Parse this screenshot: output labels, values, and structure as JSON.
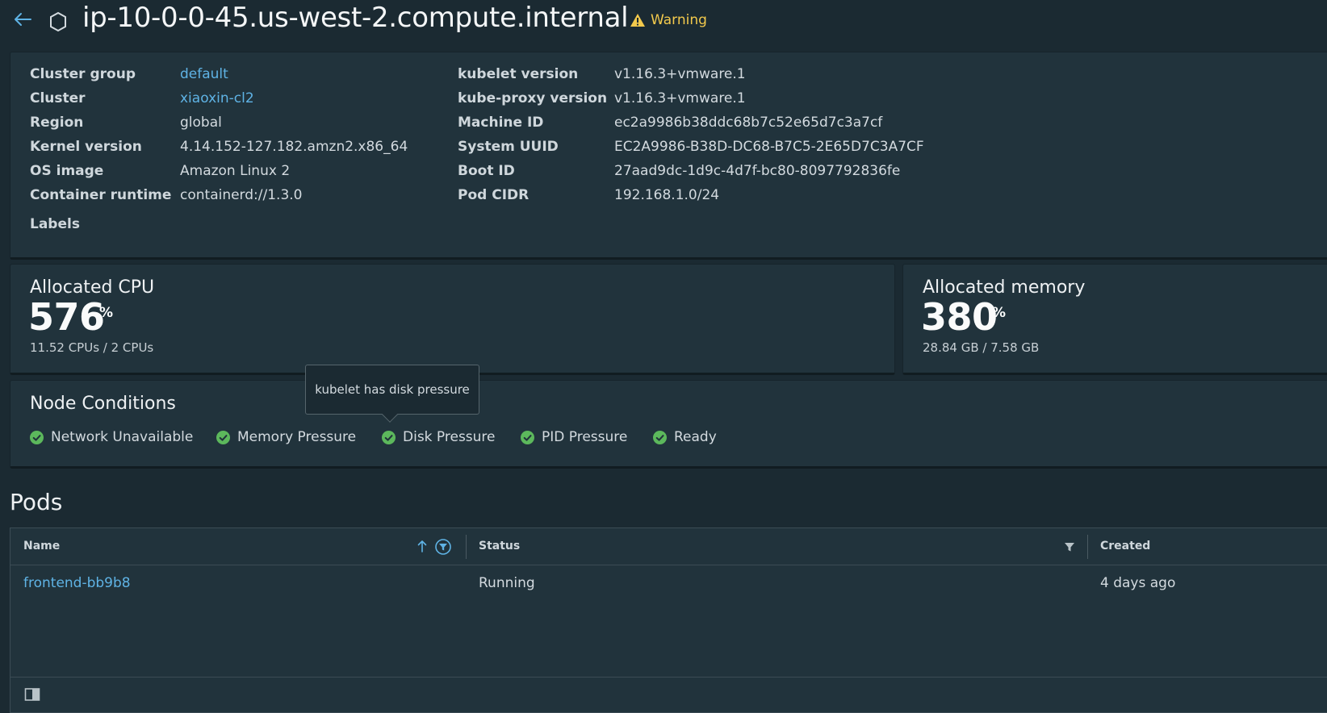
{
  "header": {
    "title": "ip-10-0-0-45.us-west-2.compute.internal",
    "warning_label": "Warning",
    "back_icon": "arrow-left-icon",
    "node_icon": "hexagon-icon",
    "warning_icon": "warning-triangle-icon"
  },
  "details": {
    "left": [
      {
        "key": "Cluster group",
        "value": "default",
        "link": true
      },
      {
        "key": "Cluster",
        "value": "xiaoxin-cl2",
        "link": true
      },
      {
        "key": "Region",
        "value": "global",
        "link": false
      },
      {
        "key": "Kernel version",
        "value": "4.14.152-127.182.amzn2.x86_64",
        "link": false
      },
      {
        "key": "OS image",
        "value": "Amazon Linux 2",
        "link": false
      },
      {
        "key": "Container runtime",
        "value": "containerd://1.3.0",
        "link": false
      }
    ],
    "right": [
      {
        "key": "kubelet version",
        "value": "v1.16.3+vmware.1"
      },
      {
        "key": "kube-proxy version",
        "value": "v1.16.3+vmware.1"
      },
      {
        "key": "Machine ID",
        "value": "ec2a9986b38ddc68b7c52e65d7c3a7cf"
      },
      {
        "key": "System UUID",
        "value": "EC2A9986-B38D-DC68-B7C5-2E65D7C3A7CF"
      },
      {
        "key": "Boot ID",
        "value": "27aad9dc-1d9c-4d7f-bc80-8097792836fe"
      },
      {
        "key": "Pod CIDR",
        "value": "192.168.1.0/24"
      }
    ],
    "labels_key": "Labels"
  },
  "cpu": {
    "title": "Allocated CPU",
    "value": "576",
    "unit": "%",
    "sub": "11.52 CPUs / 2 CPUs"
  },
  "memory": {
    "title": "Allocated memory",
    "value": "380",
    "unit": "%",
    "sub": "28.84 GB / 7.58 GB"
  },
  "conditions": {
    "title": "Node Conditions",
    "items": [
      "Network Unavailable",
      "Memory Pressure",
      "Disk Pressure",
      "PID Pressure",
      "Ready"
    ],
    "status_icon": "check-circle-icon",
    "status_color": "#5cb85c",
    "tooltip": "kubelet has disk pressure"
  },
  "pods": {
    "title": "Pods",
    "columns": [
      "Name",
      "Status",
      "Created"
    ],
    "rows": [
      {
        "name": "frontend-bb9b8",
        "status": "Running",
        "created": "4 days ago"
      }
    ]
  },
  "colors": {
    "background": "#1b2a32",
    "panel": "#21333c",
    "link": "#5fb3e5",
    "warning": "#f2c94c"
  }
}
